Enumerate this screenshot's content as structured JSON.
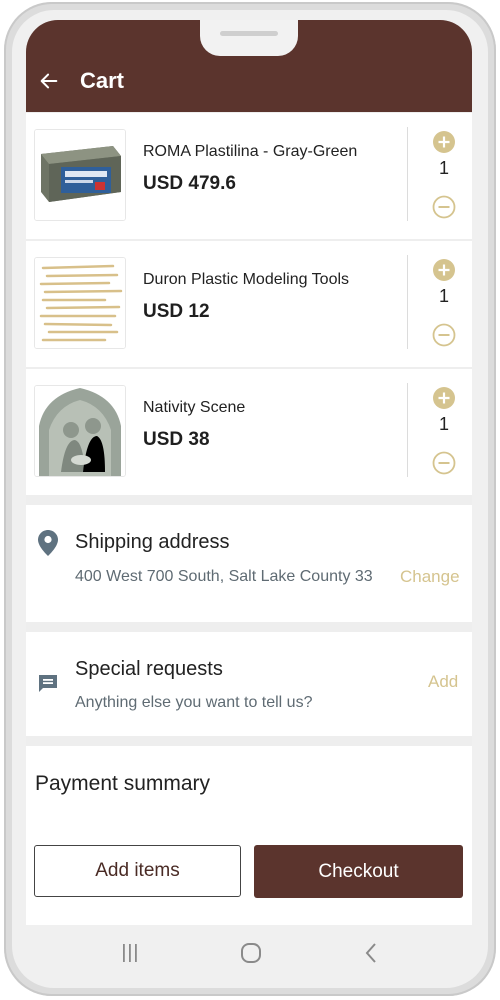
{
  "appbar": {
    "title": "Cart"
  },
  "items": [
    {
      "name": "ROMA Plastilina - Gray-Green",
      "price": "USD 479.6",
      "qty": "1",
      "image": "clay-block-image"
    },
    {
      "name": " Duron Plastic Modeling Tools",
      "price": "USD 12",
      "qty": "1",
      "image": "modeling-tools-image"
    },
    {
      "name": "Nativity Scene",
      "price": "USD 38",
      "qty": "1",
      "image": "nativity-figurine-image"
    }
  ],
  "shipping": {
    "title": "Shipping address",
    "address": "400 West 700 South, Salt Lake County 33",
    "action": "Change"
  },
  "requests": {
    "title": "Special requests",
    "placeholder": "Anything else you want to tell us?",
    "action": "Add"
  },
  "payment": {
    "title": "Payment summary"
  },
  "actions": {
    "add_items": "Add items",
    "checkout": "Checkout"
  },
  "colors": {
    "brand": "#5b342d",
    "accent": "#d5c48f",
    "icon": "#5f7280"
  },
  "nav": {
    "icons": [
      "recent-apps-icon",
      "home-icon",
      "back-nav-icon"
    ]
  }
}
